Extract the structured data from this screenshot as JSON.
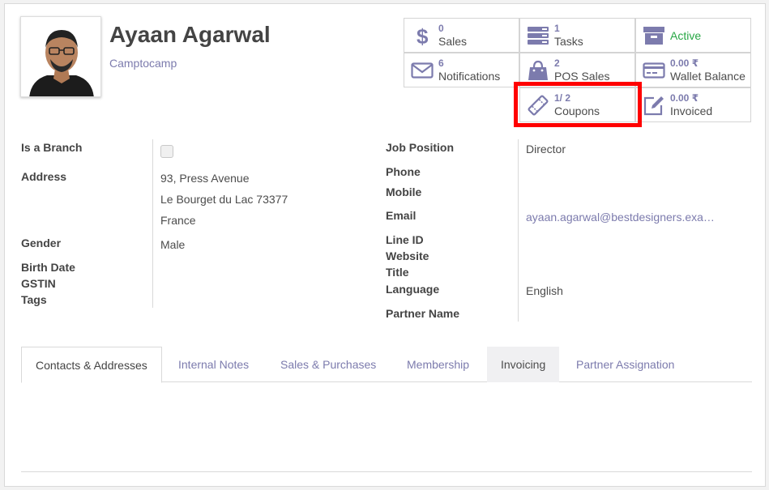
{
  "partner": {
    "name": "Ayaan Agarwal",
    "company": "Camptocamp"
  },
  "stat_buttons": [
    {
      "value": "0",
      "label": "Sales",
      "icon": "dollar-icon"
    },
    {
      "value": "1",
      "label": "Tasks",
      "icon": "tasks-icon"
    },
    {
      "value": "",
      "label": "Active",
      "icon": "archive-icon"
    },
    {
      "value": "6",
      "label": "Notifications",
      "icon": "envelope-icon"
    },
    {
      "value": "2",
      "label": "POS Sales",
      "icon": "shopping-bag-icon"
    },
    {
      "value": "0.00 ₹",
      "label": "Wallet Balance",
      "icon": "credit-card-icon"
    },
    {
      "value": "1/ 2",
      "label": "Coupons",
      "icon": "ticket-icon"
    },
    {
      "value": "0.00 ₹",
      "label": "Invoiced",
      "icon": "pencil-square-icon"
    }
  ],
  "left_fields": {
    "is_branch_label": "Is a Branch",
    "address_label": "Address",
    "address_line1": "93, Press Avenue",
    "address_line2": "Le Bourget du Lac 73377",
    "address_line3": "France",
    "gender_label": "Gender",
    "gender_value": "Male",
    "birth_date_label": "Birth Date",
    "gstin_label": "GSTIN",
    "tags_label": "Tags"
  },
  "right_fields": {
    "job_position_label": "Job Position",
    "job_position_value": "Director",
    "phone_label": "Phone",
    "mobile_label": "Mobile",
    "email_label": "Email",
    "email_value": "ayaan.agarwal@bestdesigners.exa…",
    "line_id_label": "Line ID",
    "website_label": "Website",
    "title_label": "Title",
    "language_label": "Language",
    "language_value": "English",
    "partner_name_label": "Partner Name"
  },
  "tabs": [
    {
      "label": "Contacts & Addresses"
    },
    {
      "label": "Internal Notes"
    },
    {
      "label": "Sales & Purchases"
    },
    {
      "label": "Membership"
    },
    {
      "label": "Invoicing"
    },
    {
      "label": "Partner Assignation"
    }
  ],
  "colors": {
    "accent": "#7c7bad",
    "active_green": "#28a745",
    "highlight_red": "#ff0000"
  }
}
